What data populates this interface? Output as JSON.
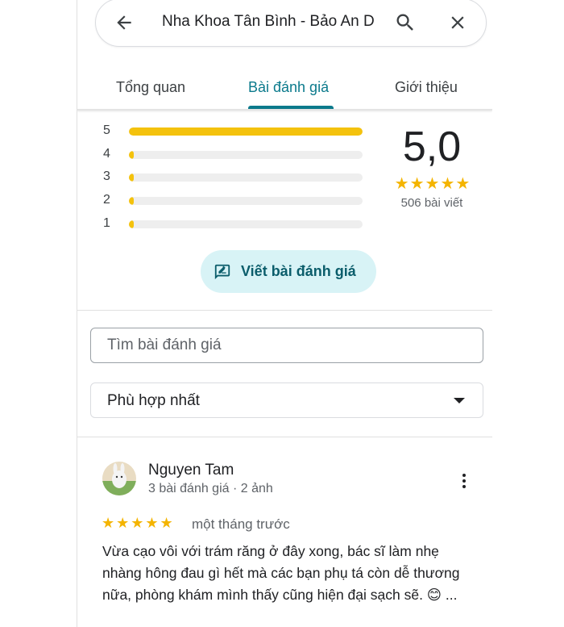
{
  "search": {
    "query": "Nha Khoa Tân Bình - Bảo An D"
  },
  "tabs": [
    {
      "label": "Tổng quan"
    },
    {
      "label": "Bài đánh giá"
    },
    {
      "label": "Giới thiệu"
    }
  ],
  "rating": {
    "histogram": [
      {
        "stars": "5",
        "fraction": 1.0
      },
      {
        "stars": "4",
        "fraction": 0.01
      },
      {
        "stars": "3",
        "fraction": 0.01
      },
      {
        "stars": "2",
        "fraction": 0.01
      },
      {
        "stars": "1",
        "fraction": 0.01
      }
    ],
    "score": "5,0",
    "stars": "★★★★★",
    "count": "506 bài viết",
    "star_color": "#f4b400",
    "bar_color": "#f4c20d"
  },
  "write_review": {
    "label": "Viết bài đánh giá"
  },
  "review_search": {
    "placeholder": "Tìm bài đánh giá"
  },
  "sort": {
    "value": "Phù hợp nhất"
  },
  "reviews": [
    {
      "name": "Nguyen Tam",
      "meta": "3 bài đánh giá · 2 ảnh",
      "stars": "★★★★★",
      "time": "một tháng trước",
      "text": "Vừa cạo vôi với trám răng ở đây xong, bác sĩ làm nhẹ nhàng hông đau gì hết mà các bạn phụ tá còn dễ thương nữa, phòng khám mình thấy cũng hiện đại sạch sẽ. 😊 ..."
    }
  ]
}
